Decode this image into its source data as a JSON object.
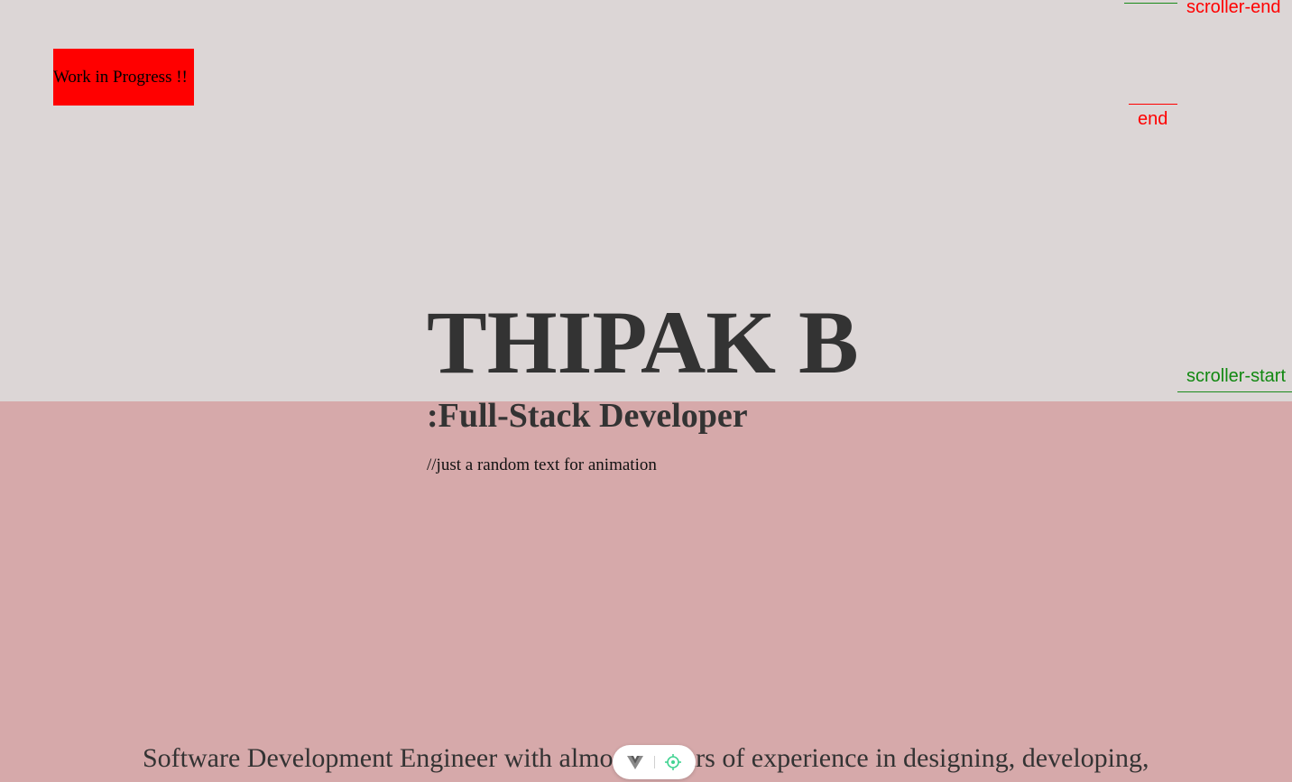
{
  "badge": {
    "label": "Work in Progress !!",
    "color": "#ff0000"
  },
  "markers": {
    "scroller_end": "scroller-end",
    "end": "end",
    "scroller_start": "scroller-start"
  },
  "hero": {
    "name": "THIPAK B",
    "role": ":Full-Stack Developer",
    "note": "//just a random text for animation"
  },
  "bio": {
    "text": "Software Development Engineer with almost 3 years of experience in designing, developing,"
  },
  "devtools": {
    "icons": [
      "vue-logo-icon",
      "target-inspect-icon"
    ]
  },
  "colors": {
    "top_bg": "#dcd6d6",
    "bottom_bg": "#d6a9aa",
    "heading": "#333333",
    "marker_red": "#ff0000",
    "marker_green": "#118811",
    "inspect_green": "#42d392"
  }
}
